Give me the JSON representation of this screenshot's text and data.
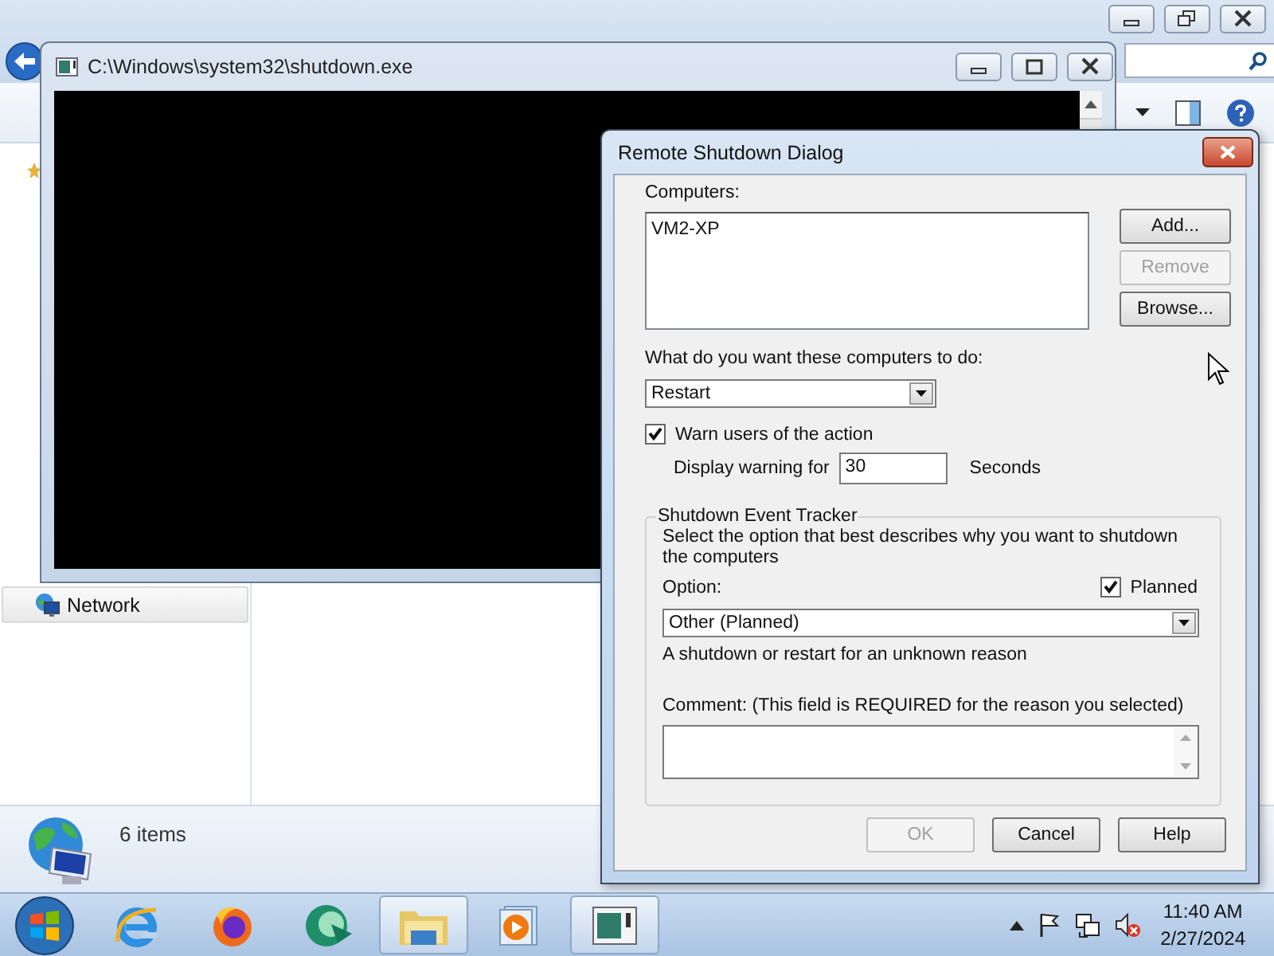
{
  "explorer": {
    "nav_items": [
      {
        "label": "Network",
        "selected": false
      }
    ],
    "status": "6 items"
  },
  "console": {
    "title": "C:\\Windows\\system32\\shutdown.exe"
  },
  "dialog": {
    "title": "Remote Shutdown Dialog",
    "computers_label": "Computers:",
    "computers": [
      "VM2-XP"
    ],
    "side_buttons": [
      {
        "label": "Add...",
        "disabled": false
      },
      {
        "label": "Remove",
        "disabled": true
      },
      {
        "label": "Browse...",
        "disabled": false
      }
    ],
    "action_label": "What do you want these computers to do:",
    "action": "Restart",
    "warn": {
      "label": "Warn users of the action",
      "checked": true
    },
    "warning_label": "Display warning for",
    "warning_seconds": "30",
    "seconds_label": "Seconds",
    "tracker": {
      "title": "Shutdown Event Tracker",
      "instructions": "Select the option that best describes why you want to shutdown the computers",
      "option_label": "Option:",
      "planned": {
        "label": "Planned",
        "checked": true
      },
      "option": "Other (Planned)",
      "description": "A shutdown or restart for an unknown reason",
      "comment_label": "Comment: (This field is REQUIRED for the reason you selected)"
    },
    "buttons": [
      {
        "label": "OK",
        "disabled": true
      },
      {
        "label": "Cancel",
        "disabled": false
      },
      {
        "label": "Help",
        "disabled": false
      }
    ]
  },
  "taskbar": {
    "apps": [
      {
        "kind": "ie",
        "open": false
      },
      {
        "kind": "firefox",
        "open": false
      },
      {
        "kind": "orb",
        "open": false
      },
      {
        "kind": "explorer",
        "open": true
      },
      {
        "kind": "media",
        "open": false
      },
      {
        "kind": "console",
        "open": true
      }
    ],
    "time": "11:40 AM",
    "date": "2/27/2024"
  }
}
